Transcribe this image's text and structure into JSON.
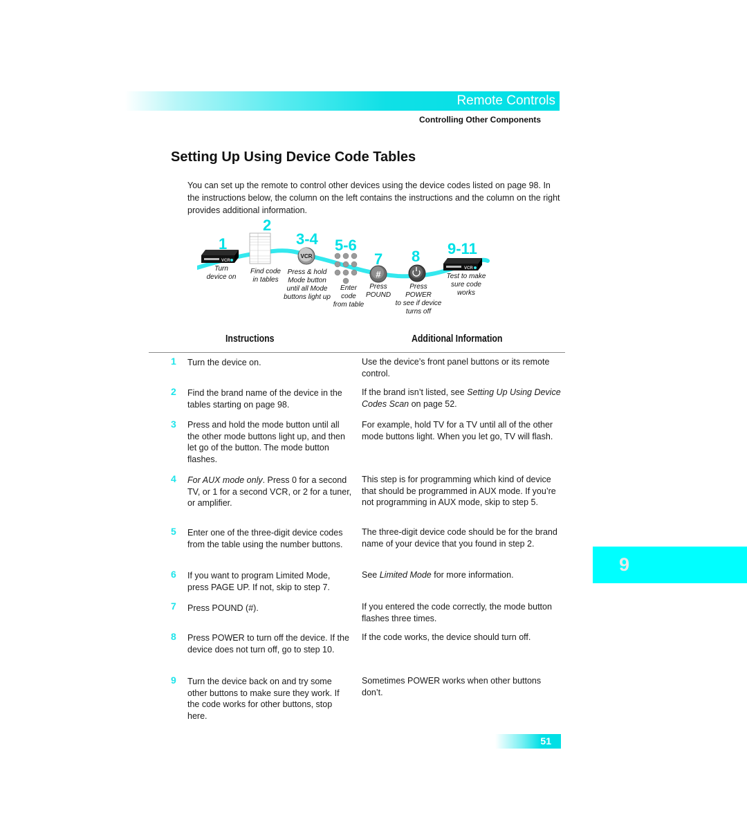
{
  "header": {
    "section_title": "Remote Controls",
    "subsection": "Controlling Other Components"
  },
  "page_title": "Setting Up Using Device Code Tables",
  "intro": "You can set up the remote to control other devices using the device codes listed on page 98. In the instructions below, the column on the left contains the instructions and the column on the right provides additional information.",
  "diagram": {
    "steps": [
      {
        "num": "1",
        "caption": "Turn\ndevice on",
        "icon": "vcr-device-icon"
      },
      {
        "num": "2",
        "caption": "Find code\nin tables",
        "icon": "code-table-icon"
      },
      {
        "num": "3-4",
        "caption": "Press & hold\nMode button\nuntil all Mode\nbuttons light up",
        "icon": "vcr-mode-button-icon",
        "button_label": "VCR"
      },
      {
        "num": "5-6",
        "caption": "Enter\ncode\nfrom table",
        "icon": "number-keypad-icon"
      },
      {
        "num": "7",
        "caption": "Press\nPOUND",
        "icon": "pound-button-icon",
        "button_label": "#"
      },
      {
        "num": "8",
        "caption": "Press\nPOWER\nto see if device\nturns off",
        "icon": "power-button-icon"
      },
      {
        "num": "9-11",
        "caption": "Test to make\nsure code\nworks",
        "icon": "vcr-device-icon"
      }
    ],
    "device_label": "VCR",
    "colors": {
      "accent": "#00e0e6",
      "curve": "#33e8ee"
    }
  },
  "table": {
    "headers": {
      "instructions": "Instructions",
      "additional": "Additional Information"
    },
    "rows": [
      {
        "num": "1",
        "instruction": "Turn the device on.",
        "info": "Use the device’s front panel buttons or its remote control."
      },
      {
        "num": "2",
        "instruction": "Find the brand name of the device in the tables starting on page 98.",
        "info_pre": "If the brand isn’t listed, see ",
        "info_em": "Setting Up Using Device Codes Scan",
        "info_post": " on page 52."
      },
      {
        "num": "3",
        "instruction": "Press and hold the mode button until all the other mode buttons light up, and then let go of the button. The mode button flashes.",
        "info": "For example, hold TV for a TV until all of the other mode buttons light. When you let go, TV will flash."
      },
      {
        "num": "4",
        "instruction_em": "For AUX mode only",
        "instruction_post": ". Press 0 for a second TV, or 1 for a second VCR, or 2 for a tuner, or amplifier.",
        "info": "This step is for programming which kind of device that should be programmed in AUX mode. If you’re not programming in AUX mode, skip to step 5."
      },
      {
        "num": "5",
        "instruction": "Enter one of the three-digit device codes from the table using the number buttons.",
        "info": "The three-digit device code should be for the brand name of your device that you found in step 2."
      },
      {
        "num": "6",
        "instruction": "If you want to program Limited Mode, press PAGE UP. If not, skip to step 7.",
        "info_pre": "See ",
        "info_em": "Limited Mode",
        "info_post": " for more information."
      },
      {
        "num": "7",
        "instruction": "Press POUND (#).",
        "info": "If you entered the code correctly, the mode button flashes three times."
      },
      {
        "num": "8",
        "instruction": "Press POWER to turn off the device. If the device does not turn off, go to step 10.",
        "info": "If the code works, the device should turn off."
      },
      {
        "num": "9",
        "instruction": "Turn the device back on and try some other buttons to make sure they work. If the code works for other buttons, stop here.",
        "info": "Sometimes POWER works when other buttons don’t."
      }
    ]
  },
  "chapter_tab": {
    "number": "9",
    "color": "#00ffff"
  },
  "page_number": "51"
}
